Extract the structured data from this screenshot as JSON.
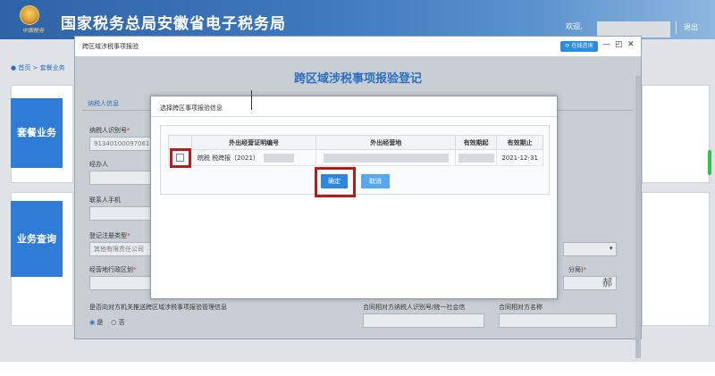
{
  "header": {
    "site_title": "国家税务总局安徽省电子税务局",
    "emblem_text": "中国税务",
    "welcome": "欢迎,",
    "logout": "退出"
  },
  "breadcrumb": {
    "home": "首页",
    "separator": ">",
    "current": "套餐业务"
  },
  "side_buttons": {
    "package": "套餐业务",
    "query": "业务查询"
  },
  "outer_modal": {
    "window_title": "跨区域涉税事项报验",
    "online_consult": "在线咨询",
    "form_title": "跨区域涉税事项报验登记",
    "section_tab": "纳税人信息",
    "fields": {
      "taxpayer_id_label": "纳税人识别号",
      "taxpayer_id_value": "91340100097061",
      "handler_label": "经办人",
      "contact_phone_label": "联系人手机",
      "reg_type_label": "登记注册类型",
      "reg_type_value": "其他有限责任公司",
      "admin_area_label": "经营地行政区划",
      "tax_bureau_suffix": "分局)",
      "bureau_char": "郝",
      "push_question": "是否向对方机关推送跨区域涉税事项报验管理信息",
      "yes": "是",
      "no": "否",
      "counterparty_id_label": "合同相对方纳税人识别号/统一社会信",
      "counterparty_name_label": "合同相对方名称"
    }
  },
  "dialog": {
    "title": "选择跨区事项报验信息",
    "columns": [
      "外出经营证明编号",
      "外出经营地",
      "有效期起",
      "有效期止"
    ],
    "rows": [
      {
        "cert_no": "皖税 税跨报〔2021〕",
        "end_date": "2021-12-31"
      }
    ],
    "ok_label": "确定",
    "cancel_label": "取消"
  },
  "colors": {
    "banner_blue": "#2f63a8",
    "accent_blue": "#2c6fc0",
    "button_blue": "#2e86de",
    "highlight_red": "#b01e1e",
    "required_red": "#d9342b"
  }
}
